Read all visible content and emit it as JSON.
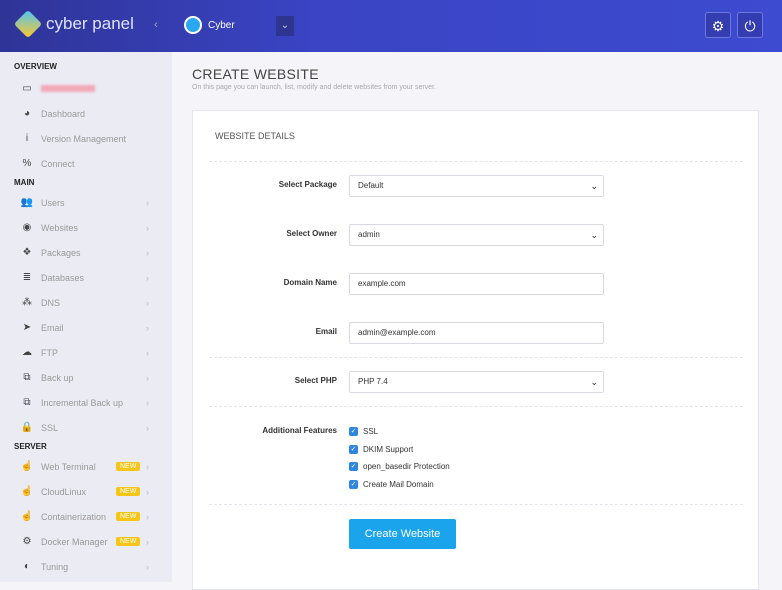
{
  "header": {
    "brand": "cyber panel",
    "collapse": "‹",
    "user": "Cyber",
    "user_dropdown": "⌄",
    "settings_icon": "⚙",
    "power_icon": "⏻"
  },
  "sidebar": {
    "sections": [
      {
        "title": "OVERVIEW",
        "items": [
          {
            "icon": "laptop",
            "glyph": "▭",
            "label": ""
          },
          {
            "icon": "dashboard",
            "glyph": "◕",
            "label": "Dashboard"
          },
          {
            "icon": "info",
            "glyph": "i",
            "label": "Version Management"
          },
          {
            "icon": "link",
            "glyph": "%",
            "label": "Connect"
          }
        ]
      },
      {
        "title": "MAIN",
        "items": [
          {
            "icon": "users",
            "glyph": "👥",
            "label": "Users"
          },
          {
            "icon": "globe",
            "glyph": "◉",
            "label": "Websites"
          },
          {
            "icon": "cubes",
            "glyph": "❖",
            "label": "Packages"
          },
          {
            "icon": "database",
            "glyph": "≣",
            "label": "Databases"
          },
          {
            "icon": "sitemap",
            "glyph": "⁂",
            "label": "DNS"
          },
          {
            "icon": "paper-plane",
            "glyph": "➤",
            "label": "Email"
          },
          {
            "icon": "cloud-upload",
            "glyph": "☁",
            "label": "FTP"
          },
          {
            "icon": "copy",
            "glyph": "⧉",
            "label": "Back up"
          },
          {
            "icon": "copy",
            "glyph": "⧉",
            "label": "Incremental Back up"
          },
          {
            "icon": "lock",
            "glyph": "🔒",
            "label": "SSL"
          }
        ]
      },
      {
        "title": "SERVER",
        "items": [
          {
            "icon": "hand",
            "glyph": "☝",
            "label": "Web Terminal",
            "badge": "NEW"
          },
          {
            "icon": "hand",
            "glyph": "☝",
            "label": "CloudLinux",
            "badge": "NEW"
          },
          {
            "icon": "hand",
            "glyph": "☝",
            "label": "Containerization",
            "badge": "NEW"
          },
          {
            "icon": "cogs",
            "glyph": "⚙",
            "label": "Docker Manager",
            "badge": "NEW"
          },
          {
            "icon": "adjust",
            "glyph": "◐",
            "label": "Tuning"
          }
        ]
      }
    ]
  },
  "page": {
    "title": "CREATE WEBSITE",
    "subtitle": "On this page you can launch, list, modify and delete websites from your server."
  },
  "form": {
    "section_title": "WEBSITE DETAILS",
    "package_label": "Select Package",
    "package_value": "Default",
    "owner_label": "Select Owner",
    "owner_value": "admin",
    "domain_label": "Domain Name",
    "domain_value": "example.com",
    "email_label": "Email",
    "email_value": "admin@example.com",
    "php_label": "Select PHP",
    "php_value": "PHP 7.4",
    "features_label": "Additional Features",
    "features": [
      {
        "label": "SSL",
        "checked": true
      },
      {
        "label": "DKIM Support",
        "checked": true
      },
      {
        "label": "open_basedir Protection",
        "checked": true
      },
      {
        "label": "Create Mail Domain",
        "checked": true
      }
    ],
    "submit": "Create Website"
  },
  "colors": {
    "accent": "#1aa4ec",
    "badge": "#f5c518"
  }
}
